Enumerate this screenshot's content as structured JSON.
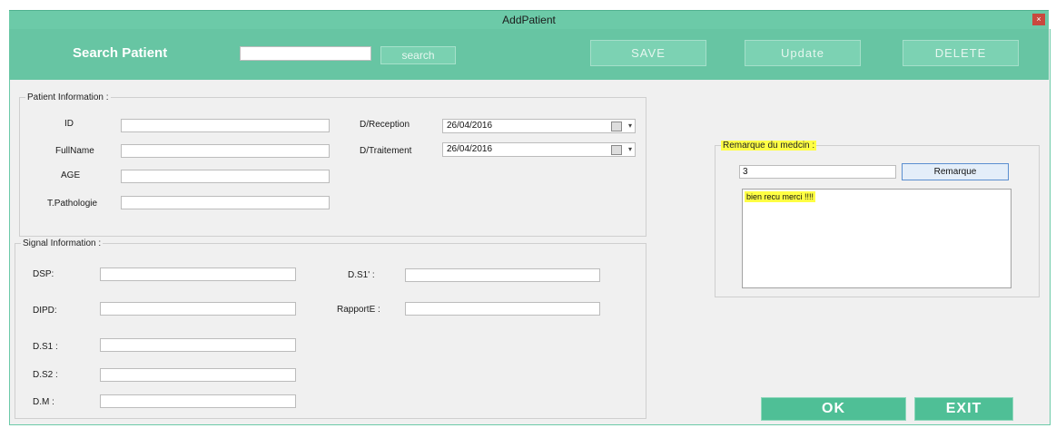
{
  "window": {
    "title": "AddPatient",
    "close_glyph": "×"
  },
  "toolbar": {
    "search_label": "Search Patient",
    "search_value": "",
    "search_button": "search",
    "save": "SAVE",
    "update": "Update",
    "delete": "DELETE"
  },
  "patient": {
    "legend": "Patient Information :",
    "id_label": "ID",
    "id_value": "",
    "fullname_label": "FullName",
    "fullname_value": "",
    "age_label": "AGE",
    "age_value": "",
    "patho_label": "T.Pathologie",
    "patho_value": "",
    "reception_label": "D/Reception",
    "reception_value": "26/04/2016",
    "traitement_label": "D/Traitement",
    "traitement_value": "26/04/2016"
  },
  "signal": {
    "legend": "Signal Information :",
    "dsp_label": "DSP:",
    "dipd_label": "DIPD:",
    "ds1_label": "D.S1 :",
    "ds2_label": "D.S2 :",
    "dm_label": "D.M :",
    "ds1p_label": "D.S1' :",
    "rapport_label": "RapportE :"
  },
  "remarque": {
    "legend": "Remarque du medcin :",
    "id_value": "3",
    "button": "Remarque",
    "text": "bien recu merci !!!!"
  },
  "actions": {
    "ok": "OK",
    "exit": "EXIT"
  }
}
